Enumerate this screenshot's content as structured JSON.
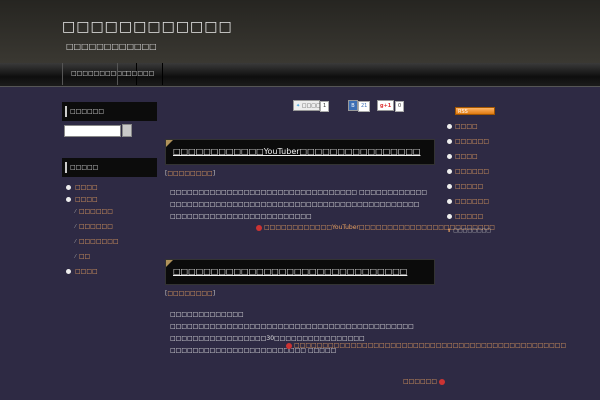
{
  "header": {
    "title": "□□□□□□□□□□□□",
    "description": "□□□□□□□□□□□□"
  },
  "nav": {
    "items": [
      {
        "label": "□□□□□□□□□□"
      },
      {
        "label": "□□□□□"
      }
    ]
  },
  "left_sidebar": {
    "search": {
      "title": "□□□□□□",
      "value": "",
      "button": ""
    },
    "categories": {
      "title": "□□□□□",
      "items": [
        {
          "label": "□□□□"
        },
        {
          "label": "□□□□"
        },
        {
          "label": "□□□□□□"
        },
        {
          "label": "□□□□□□"
        },
        {
          "label": "□□□□□□□"
        },
        {
          "label": "□□"
        },
        {
          "label": "□□□□"
        }
      ]
    }
  },
  "share": {
    "tweet": "□□□□",
    "tweet_count": "1",
    "hatena_count": "21",
    "gplus": "+1",
    "gplus_count": "0"
  },
  "posts": [
    {
      "title": "□□□□□□□□□□□□YouTuber□□□□□□□□□□□□□□□□",
      "category": "□□□□□□□□",
      "body": "□□□□□□□□□□□□□□□□□□□□□□□□□□□□□□□□□ □□□□□□□□□□□□ □□□□□□□□□□□□□□□□□□□□□□□□□□□□□□□□□□□□□□□□□□□□ □□□□□□□□□□□□□□□□□□□□□□□□□",
      "read_more": "□□□□□□□□□□□□YouTuber□□□□□□□□□□□□□□□□□□□□□□□□"
    },
    {
      "title": "□□□□□□□□□□□□□□□□□□□□□□□□□□□□□□□",
      "category": "□□□□□□□□",
      "body": "□□□□□□□□□□□□□ □□□□□□□□□□□□□□□□□□□□□□□□□□□□□□□□□□□□□□□□□□□ □□□□□□□□□□□□□□□□□30□□□□□□□□□□□□□□□□ □□□□□□□□□□□□□□□□□□□□□□□□ □□□□□",
      "read_more": "□□□□□□□□□□□□□□□□□□□□□□□□□□□□□□□□□□□□□□□□□□□□□□□□"
    }
  ],
  "pagination": {
    "next": "□□□□□□"
  },
  "right_sidebar": {
    "rss_label": "RSS",
    "items": [
      {
        "label": "□□□□"
      },
      {
        "label": "□□□□□□"
      },
      {
        "label": "□□□□"
      },
      {
        "label": "□□□□□□"
      },
      {
        "label": "□□□□□"
      },
      {
        "label": "□□□□□□"
      },
      {
        "label": "□□□□□"
      }
    ],
    "tagline": "□□□□□□□□"
  }
}
